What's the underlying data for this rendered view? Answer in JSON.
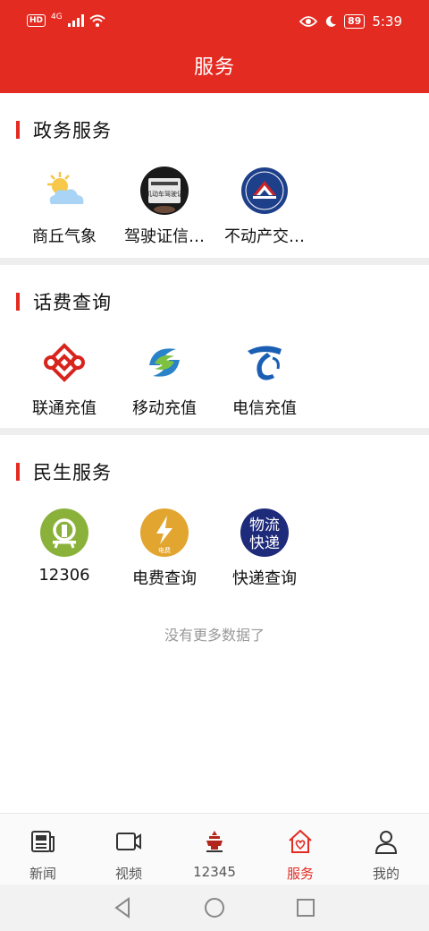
{
  "status_bar": {
    "hd": "HD",
    "network": "4G",
    "battery": "89",
    "time": "5:39"
  },
  "header": {
    "title": "服务"
  },
  "sections": [
    {
      "title": "政务服务",
      "items": [
        {
          "label": "商丘气象",
          "icon": "weather-icon"
        },
        {
          "label": "驾驶证信…",
          "icon": "driver-license-icon",
          "icon_text": "机动车驾驶证"
        },
        {
          "label": "不动产交…",
          "icon": "real-estate-icon"
        }
      ]
    },
    {
      "title": "话费查询",
      "items": [
        {
          "label": "联通充值",
          "icon": "china-unicom-icon"
        },
        {
          "label": "移动充值",
          "icon": "china-mobile-icon"
        },
        {
          "label": "电信充值",
          "icon": "china-telecom-icon"
        }
      ]
    },
    {
      "title": "民生服务",
      "items": [
        {
          "label": "12306",
          "icon": "railway-icon"
        },
        {
          "label": "电费查询",
          "icon": "electricity-icon",
          "icon_text": "电费"
        },
        {
          "label": "快递查询",
          "icon": "express-icon",
          "icon_text_1": "物流",
          "icon_text_2": "快递"
        }
      ]
    }
  ],
  "footer_note": "没有更多数据了",
  "bottom_nav": {
    "active": "服务",
    "items": [
      {
        "label": "新闻",
        "icon": "news-icon"
      },
      {
        "label": "视频",
        "icon": "video-icon"
      },
      {
        "label": "12345",
        "icon": "hotline-icon"
      },
      {
        "label": "服务",
        "icon": "home-heart-icon"
      },
      {
        "label": "我的",
        "icon": "profile-icon"
      }
    ]
  },
  "colors": {
    "brand_red": "#e42b22",
    "divider": "#eeeeee",
    "muted_text": "#999999"
  }
}
